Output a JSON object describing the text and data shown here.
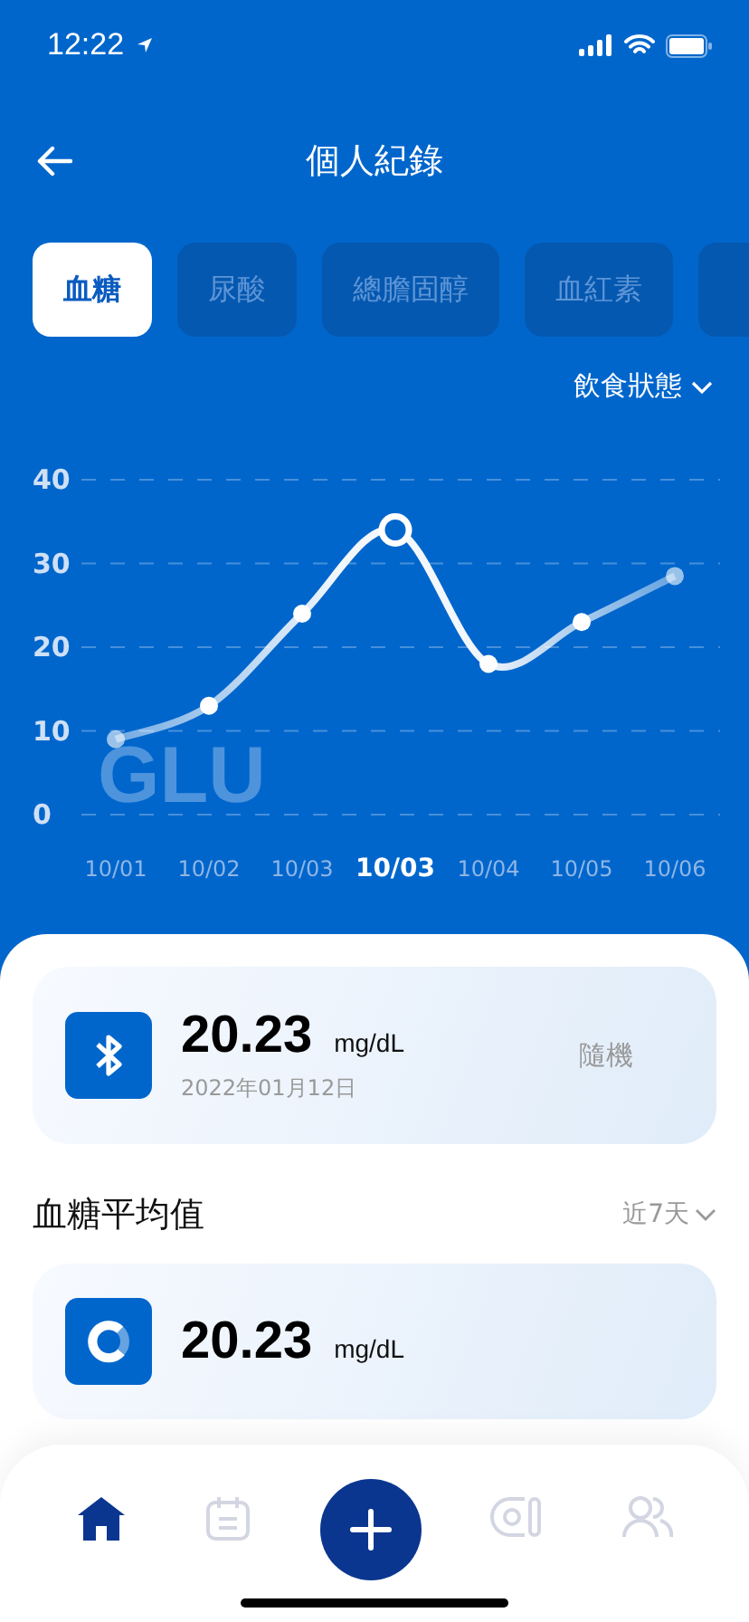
{
  "status_bar": {
    "time": "12:22"
  },
  "header": {
    "title": "個人紀錄"
  },
  "tabs": [
    {
      "label": "血糖",
      "selected": true
    },
    {
      "label": "尿酸",
      "selected": false
    },
    {
      "label": "總膽固醇",
      "selected": false
    },
    {
      "label": "血紅素",
      "selected": false
    },
    {
      "selected": false
    }
  ],
  "filter": {
    "label": "飲食狀態"
  },
  "chart": {
    "points": [
      {
        "selected": false
      },
      {
        "selected": false
      },
      {
        "selected": false
      },
      {
        "selected": true
      },
      {
        "selected": false
      },
      {
        "selected": false
      },
      {
        "selected": false
      }
    ],
    "chart_data": {
      "type": "line",
      "categories": [
        "10/01",
        "10/02",
        "10/03",
        "10/03",
        "10/04",
        "10/05",
        "10/06"
      ],
      "series": [
        {
          "name": "GLU",
          "color": "#ffffff",
          "marker": true,
          "values": [
            9,
            13,
            24,
            34,
            18,
            23,
            28.5
          ]
        }
      ],
      "ylim": [
        0,
        40
      ],
      "yticks": [
        0,
        10,
        20,
        30,
        40
      ],
      "grid": true
    }
  },
  "latest": {
    "value": "20.23",
    "unit": "mg/dL",
    "date": "2022年01月12日",
    "tag": "隨機"
  },
  "average": {
    "title": "血糖平均值",
    "range": "近7天",
    "value": "20.23",
    "unit": "mg/dL"
  },
  "nav": [
    {
      "kind": "home",
      "selected": true
    },
    {
      "kind": "calendar",
      "selected": false
    },
    {
      "kind": "add"
    },
    {
      "kind": "device",
      "selected": false
    },
    {
      "kind": "people",
      "selected": false
    }
  ]
}
